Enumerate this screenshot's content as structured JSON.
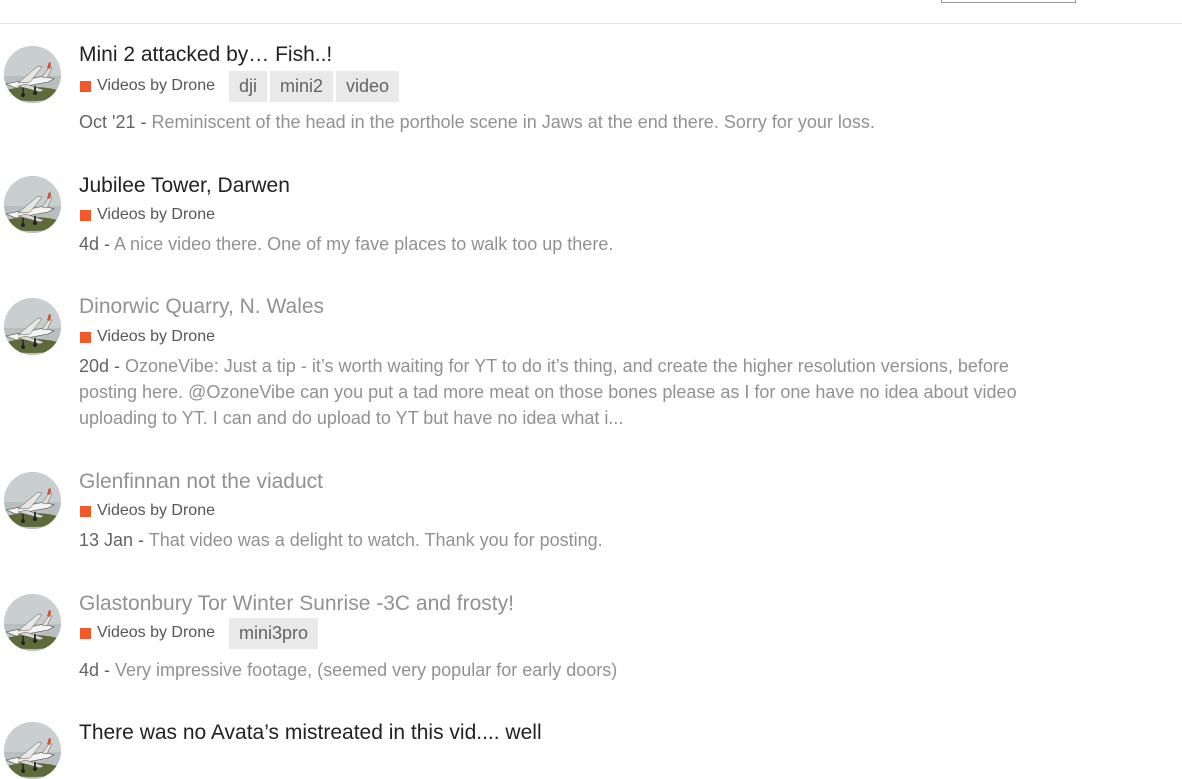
{
  "topics": [
    {
      "title": "Mini 2 attacked by… Fish..!",
      "read": false,
      "category": "Videos by Drone",
      "tags": [
        "dji",
        "mini2",
        "video"
      ],
      "date": "Oct '21",
      "excerpt": "Reminiscent of the head in the porthole scene in Jaws at the end there. Sorry for your loss."
    },
    {
      "title": "Jubilee Tower, Darwen",
      "read": false,
      "category": "Videos by Drone",
      "tags": [],
      "date": "4d",
      "excerpt": "A nice video there. One of my fave places to walk too up there."
    },
    {
      "title": "Dinorwic Quarry, N. Wales",
      "read": true,
      "category": "Videos by Drone",
      "tags": [],
      "date": "20d",
      "excerpt": "OzoneVibe: Just a tip - it’s worth waiting for YT to do it’s thing, and create the higher resolution versions, before posting here. @OzoneVibe can you put a tad more meat on those bones please as I for one have no idea about video uploading to YT. I can and do upload to YT but have no idea what i..."
    },
    {
      "title": "Glenfinnan not the viaduct",
      "read": true,
      "category": "Videos by Drone",
      "tags": [],
      "date": "13 Jan",
      "excerpt": "That video was a delight to watch. Thank you for posting."
    },
    {
      "title": "Glastonbury Tor Winter Sunrise -3C and frosty!",
      "read": true,
      "category": "Videos by Drone",
      "tags": [
        "mini3pro"
      ],
      "date": "4d",
      "excerpt": "Very impressive footage, (seemed very popular for early doors)"
    },
    {
      "title": "There was no Avata’s mistreated in this vid.... well",
      "read": false,
      "category": "",
      "tags": [],
      "date": "",
      "excerpt": ""
    }
  ],
  "colors": {
    "category_swatch": "#f1592a",
    "unread_title": "#222222",
    "read_title": "#919191",
    "excerpt_text": "#919191",
    "date_text": "#646464",
    "tag_bg": "#e9e9e9"
  },
  "icons": {
    "avatar": "user-avatar-aircraft-photo"
  }
}
